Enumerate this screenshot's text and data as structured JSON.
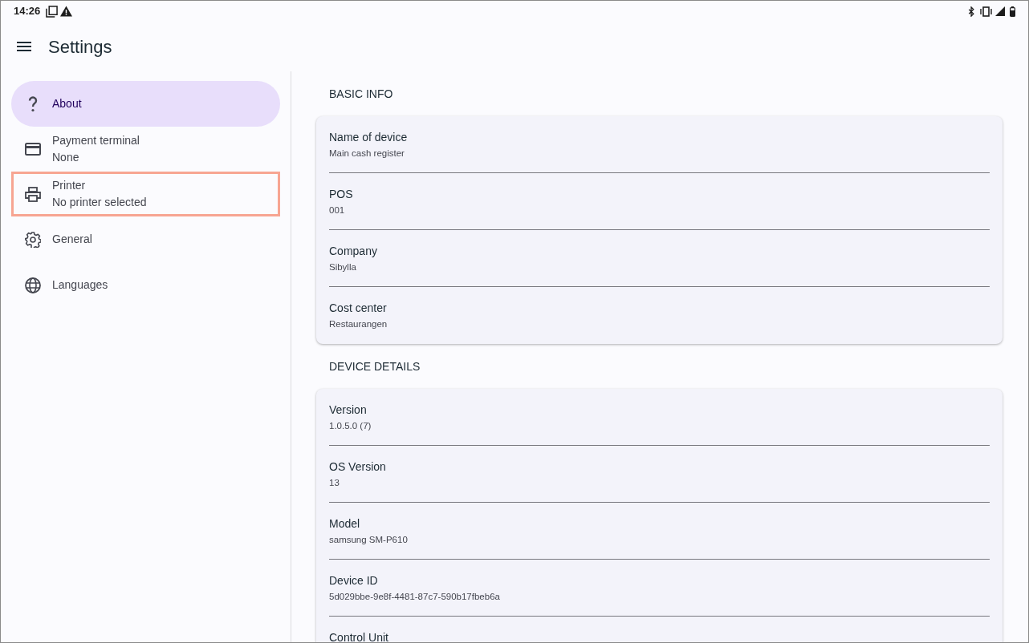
{
  "status_bar": {
    "time": "14:26"
  },
  "app_bar": {
    "title": "Settings"
  },
  "sidebar": {
    "items": [
      {
        "kind": "help",
        "label": "About",
        "selected": true,
        "highlighted": false
      },
      {
        "kind": "card",
        "label": "Payment terminal",
        "subtitle": "None",
        "selected": false,
        "highlighted": false
      },
      {
        "kind": "printer",
        "label": "Printer",
        "subtitle": "No printer selected",
        "selected": false,
        "highlighted": true
      },
      {
        "kind": "gear",
        "label": "General",
        "selected": false,
        "highlighted": false
      },
      {
        "kind": "globe",
        "label": "Languages",
        "selected": false,
        "highlighted": false
      }
    ]
  },
  "sections": [
    {
      "title": "BASIC INFO",
      "rows": [
        {
          "label": "Name of device",
          "value": "Main cash register"
        },
        {
          "label": "POS",
          "value": "001"
        },
        {
          "label": "Company",
          "value": "Sibylla"
        },
        {
          "label": "Cost center",
          "value": "Restaurangen"
        }
      ]
    },
    {
      "title": "DEVICE DETAILS",
      "rows": [
        {
          "label": "Version",
          "value": "1.0.5.0 (7)"
        },
        {
          "label": "OS Version",
          "value": "13"
        },
        {
          "label": "Model",
          "value": "samsung SM-P610"
        },
        {
          "label": "Device ID",
          "value": "5d029bbe-9e8f-4481-87c7-590b17fbeb6a"
        },
        {
          "label": "Control Unit"
        }
      ]
    }
  ]
}
